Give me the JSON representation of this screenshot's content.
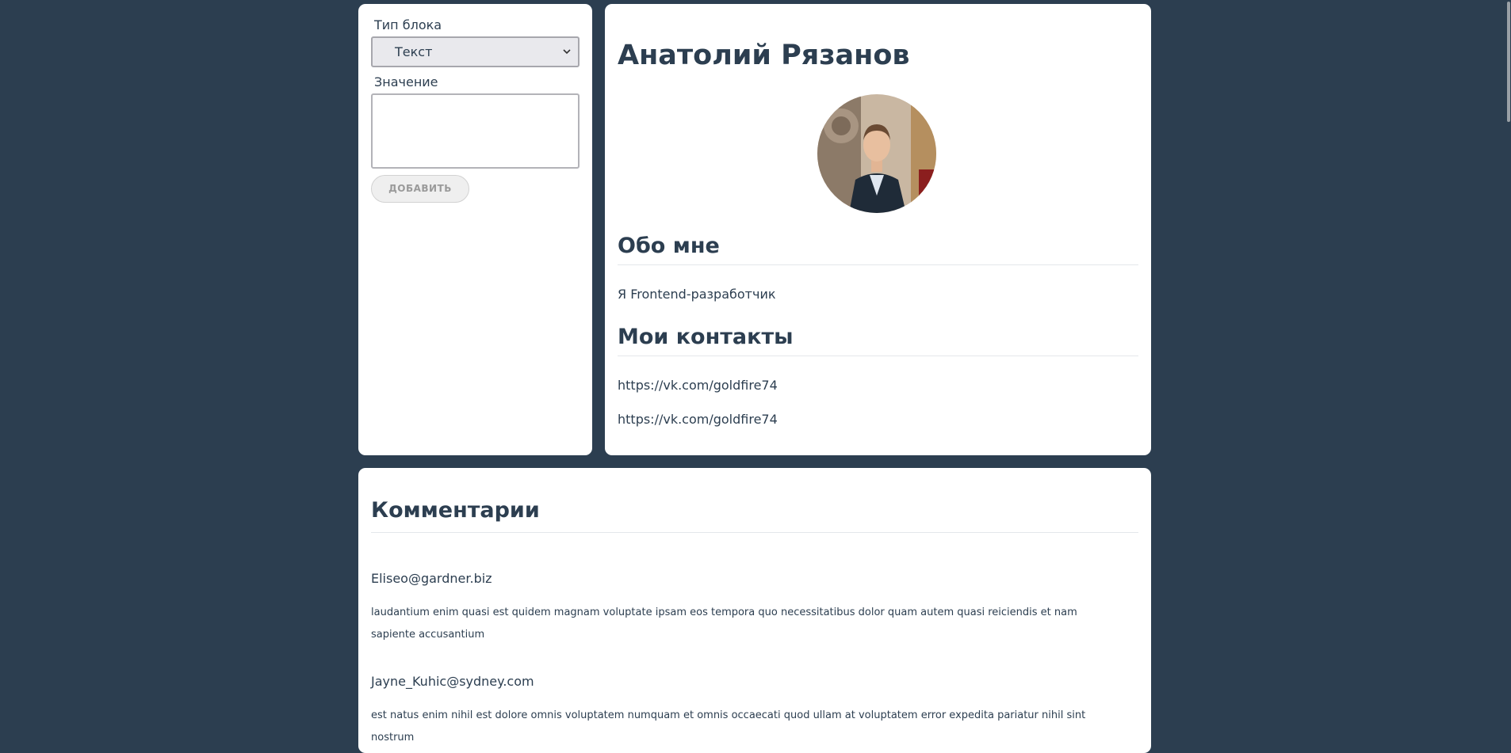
{
  "form": {
    "type_label": "Тип блока",
    "type_select_value": "Текст",
    "value_label": "Значение",
    "value_input": "",
    "add_button_label": "ДОБАВИТЬ"
  },
  "profile": {
    "name": "Анатолий Рязанов",
    "avatar_icon": "person-photo",
    "about_title": "Обо мне",
    "about_text": "Я Frontend-разработчик",
    "contacts_title": "Мои контакты",
    "contacts": [
      "https://vk.com/goldfire74",
      "https://vk.com/goldfire74"
    ]
  },
  "comments": {
    "title": "Комментарии",
    "items": [
      {
        "author": "Eliseo@gardner.biz",
        "body": "laudantium enim quasi est quidem magnam voluptate ipsam eos tempora quo necessitatibus dolor quam autem quasi reiciendis et nam sapiente accusantium"
      },
      {
        "author": "Jayne_Kuhic@sydney.com",
        "body": "est natus enim nihil est dolore omnis voluptatem numquam et omnis occaecati quod ullam at voluptatem error expedita pariatur nihil sint nostrum"
      }
    ]
  },
  "colors": {
    "page_background": "#2c3e50",
    "card_background": "#ffffff",
    "text": "#2c3e50"
  }
}
